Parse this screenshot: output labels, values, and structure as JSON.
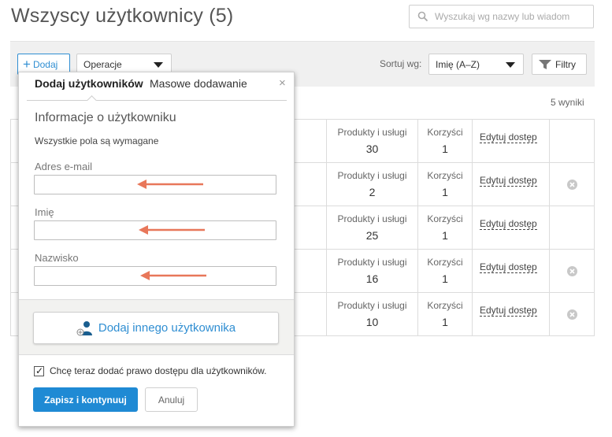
{
  "page": {
    "title": "Wszyscy użytkownicy (5)"
  },
  "search": {
    "placeholder": "Wyszukaj wg nazwy lub wiadom"
  },
  "toolbar": {
    "add_label": "Dodaj",
    "operations_label": "Operacje",
    "sort_label": "Sortuj wg:",
    "sort_value": "Imię (A–Z)",
    "filters_label": "Filtry"
  },
  "results": {
    "count_text": "5 wyniki"
  },
  "table": {
    "rows": [
      {
        "products_label": "Produkty i usługi",
        "products_value": "30",
        "benefits_label": "Korzyści",
        "benefits_value": "1",
        "edit_label": "Edytuj dostęp",
        "removable": false
      },
      {
        "products_label": "Produkty i usługi",
        "products_value": "2",
        "benefits_label": "Korzyści",
        "benefits_value": "1",
        "edit_label": "Edytuj dostęp",
        "removable": true
      },
      {
        "products_label": "Produkty i usługi",
        "products_value": "25",
        "benefits_label": "Korzyści",
        "benefits_value": "1",
        "edit_label": "Edytuj dostęp",
        "removable": false
      },
      {
        "products_label": "Produkty i usługi",
        "products_value": "16",
        "benefits_label": "Korzyści",
        "benefits_value": "1",
        "edit_label": "Edytuj dostęp",
        "removable": true
      },
      {
        "products_label": "Produkty i usługi",
        "products_value": "10",
        "benefits_label": "Korzyści",
        "benefits_value": "1",
        "edit_label": "Edytuj dostęp",
        "removable": true
      }
    ]
  },
  "panel": {
    "tab_active": "Dodaj użytkowników",
    "tab_other": "Masowe dodawanie",
    "close_glyph": "×",
    "section_title": "Informacje o użytkowniku",
    "required_note": "Wszystkie pola są wymagane",
    "fields": {
      "email_label": "Adres e-mail",
      "first_name_label": "Imię",
      "last_name_label": "Nazwisko"
    },
    "add_another_label": "Dodaj innego użytkownika",
    "checkbox_label": "Chcę teraz dodać prawo dostępu dla użytkowników.",
    "checkbox_checked": true,
    "save_label": "Zapisz i kontynuuj",
    "cancel_label": "Anuluj"
  },
  "colors": {
    "accent": "#2f8ed2",
    "primary_button": "#1f8ad4",
    "annotation_arrow": "#e8775a"
  }
}
